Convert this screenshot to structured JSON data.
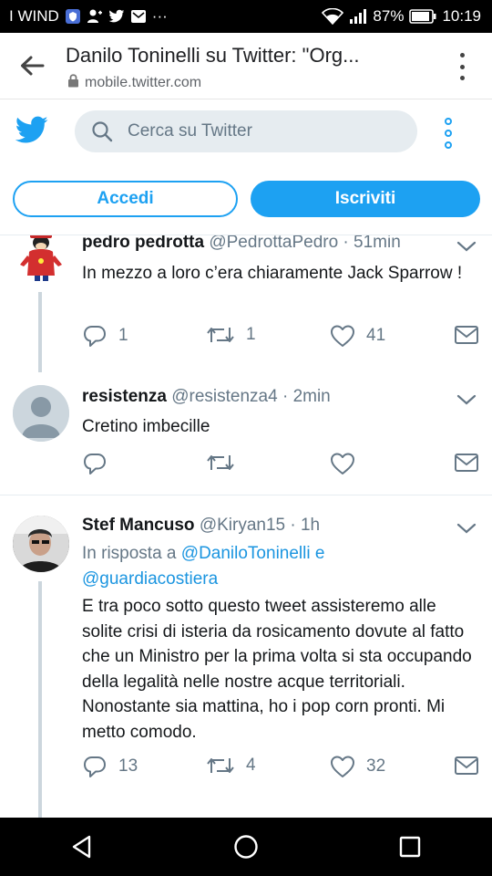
{
  "status_bar": {
    "carrier": "I WIND",
    "overflow": "···",
    "battery_percent": "87%",
    "time": "10:19"
  },
  "browser": {
    "title": "Danilo Toninelli su Twitter: \"Org...",
    "url": "mobile.twitter.com"
  },
  "twitter_header": {
    "search_placeholder": "Cerca su Twitter",
    "login_label": "Accedi",
    "signup_label": "Iscriviti"
  },
  "tweets": [
    {
      "name": "pedro pedrotta",
      "meta": "@PedrottaPedro · 51min",
      "text": "In mezzo a loro c’era chiaramente Jack Sparrow !",
      "replies": "1",
      "retweets": "1",
      "likes": "41"
    },
    {
      "name": "resistenza",
      "meta": "@resistenza4 · 2min",
      "text": "Cretino imbecille",
      "replies": "",
      "retweets": "",
      "likes": ""
    },
    {
      "name": "Stef Mancuso",
      "meta": "@Kiryan15 · 1h",
      "reply_prefix": "In risposta a",
      "reply_mention_1": "@DaniloToninelli",
      "reply_conj": "e",
      "reply_mention_2": "@guardiacostiera",
      "text": "E tra poco sotto questo tweet assisteremo alle solite crisi di isteria da rosicamento dovute al fatto che un Ministro per la prima volta si sta occupando della legalità nelle nostre acque territoriali. Nonostante sia mattina, ho i pop corn pronti. Mi metto comodo.",
      "replies": "13",
      "retweets": "4",
      "likes": "32"
    }
  ],
  "colors": {
    "twitter_blue": "#1da1f2",
    "mention_blue": "#1b95e0",
    "muted_gray": "#657786",
    "divider": "#e6ecf0"
  },
  "icons": [
    "back-arrow-icon",
    "lock-icon",
    "twitter-bird-icon",
    "search-icon",
    "reply-icon",
    "retweet-icon",
    "like-icon",
    "message-icon",
    "chevron-down-icon",
    "nav-back-icon",
    "nav-home-icon",
    "nav-recents-icon"
  ]
}
